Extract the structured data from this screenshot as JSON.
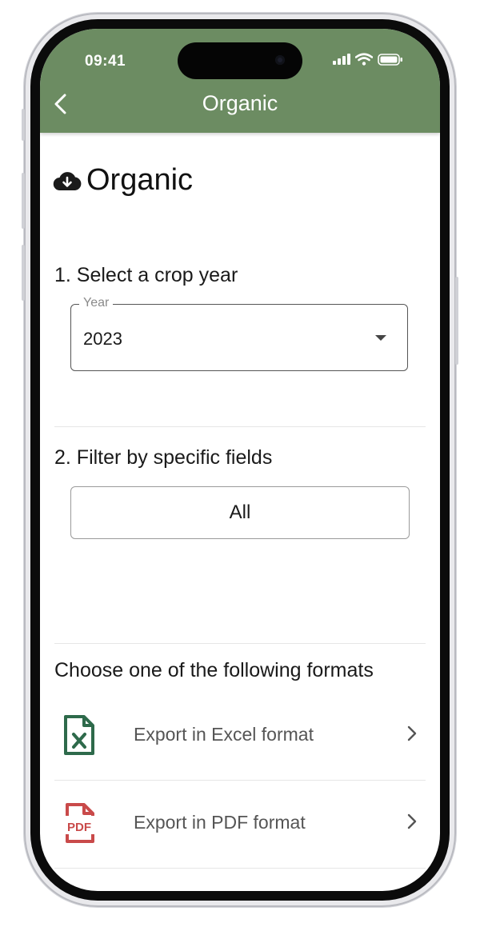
{
  "status_bar": {
    "time": "09:41"
  },
  "nav": {
    "title": "Organic"
  },
  "page": {
    "heading": "Organic"
  },
  "crop_year": {
    "section_label": "1. Select a crop year",
    "field_label": "Year",
    "value": "2023"
  },
  "fields_filter": {
    "section_label": "2. Filter by specific fields",
    "button_label": "All"
  },
  "formats": {
    "section_label": "Choose one of the following formats",
    "items": [
      {
        "label": "Export in Excel format",
        "icon": "excel-file-icon",
        "color": "#2e6a4b"
      },
      {
        "label": "Export in PDF format",
        "icon": "pdf-file-icon",
        "color": "#c94a4a"
      }
    ]
  },
  "colors": {
    "header": "#6c8c62"
  }
}
